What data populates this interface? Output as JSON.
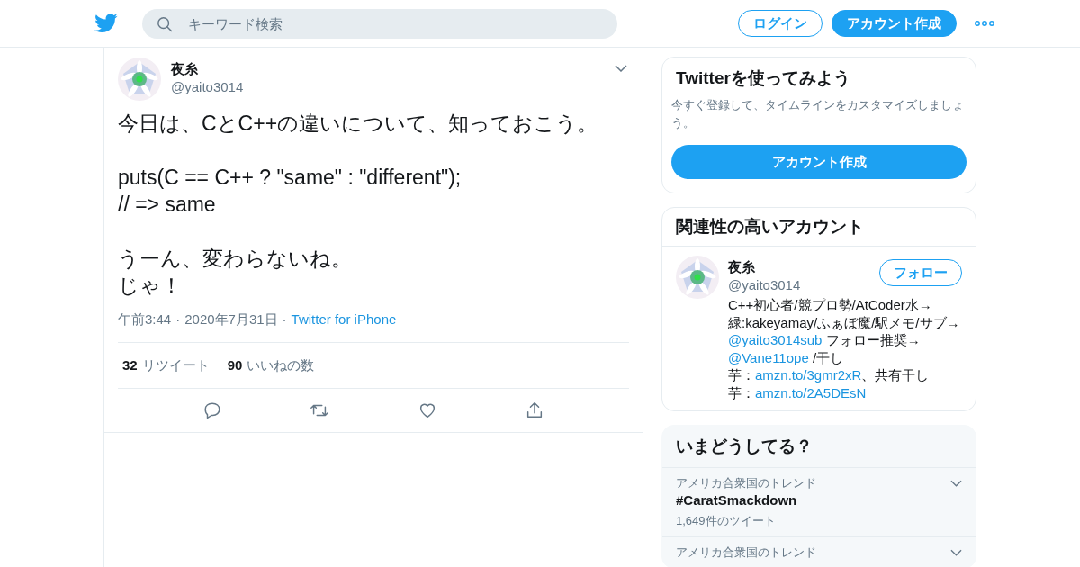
{
  "header": {
    "search": {
      "placeholder": "キーワード検索"
    },
    "buttons": [
      {
        "label": "ログイン",
        "kind": "outline"
      },
      {
        "label": "アカウント作成",
        "kind": "filled"
      }
    ]
  },
  "tweet": {
    "name": "夜糸",
    "handle": "@yaito3014",
    "paragraphs": [
      [
        "今日は、CとC++の違いについて、知っておこう。"
      ],
      [
        "puts(C == C++ ? \"same\" : \"different\");",
        "// => same"
      ],
      [
        "うーん、変わらないね。",
        "じゃ！"
      ]
    ],
    "meta": [
      {
        "kind": "time",
        "text": "午前3:44"
      },
      {
        "kind": "separator",
        "text": "·"
      },
      {
        "kind": "date",
        "text": "2020年7月31日"
      },
      {
        "kind": "separator",
        "text": "·"
      },
      {
        "kind": "source",
        "text": "Twitter for iPhone"
      }
    ],
    "stats": [
      {
        "count": "32",
        "label": "リツイート"
      },
      {
        "count": "90",
        "label": "いいねの数"
      }
    ]
  },
  "signup_card": {
    "title": "Twitterを使ってみよう",
    "description": "今すぐ登録して、タイムラインをカスタマイズしましょう。",
    "button": "アカウント作成"
  },
  "related": {
    "title": "関連性の高いアカウント",
    "accounts": [
      {
        "name": "夜糸",
        "handle": "@yaito3014",
        "follow": "フォロー",
        "bio": [
          [
            {
              "kind": "text",
              "text": "C++初心者/競プロ勢/AtCoder水→"
            }
          ],
          [
            {
              "kind": "text",
              "text": "緑:kakeyamay/ふぁぼ魔/駅メモ/サブ→"
            }
          ],
          [
            {
              "kind": "link",
              "text": "@yaito3014sub"
            },
            {
              "kind": "text",
              "text": " フォロー推奨→"
            }
          ],
          [
            {
              "kind": "link",
              "text": "@Vane11ope"
            },
            {
              "kind": "text",
              "text": " /干し"
            }
          ],
          [
            {
              "kind": "text",
              "text": "芋："
            },
            {
              "kind": "link",
              "text": "amzn.to/3gmr2xR"
            },
            {
              "kind": "text",
              "text": "、共有干し"
            }
          ],
          [
            {
              "kind": "text",
              "text": "芋："
            },
            {
              "kind": "link",
              "text": "amzn.to/2A5DEsN"
            }
          ]
        ]
      }
    ]
  },
  "trends": {
    "title": "いまどうしてる？",
    "items": [
      {
        "location": "アメリカ合衆国のトレンド",
        "tag": "#CaratSmackdown",
        "count": "1,649件のツイート"
      },
      {
        "location": "アメリカ合衆国のトレンド"
      }
    ]
  }
}
